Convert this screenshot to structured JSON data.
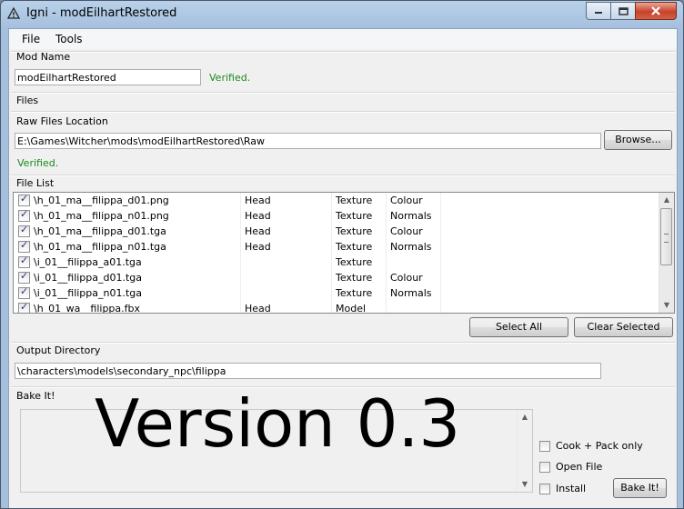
{
  "window": {
    "title": "Igni - modEilhartRestored"
  },
  "menu": {
    "file": "File",
    "tools": "Tools"
  },
  "mod_name": {
    "label": "Mod Name",
    "value": "modEilhartRestored",
    "status": "Verified."
  },
  "files_section": {
    "label": "Files"
  },
  "raw_files": {
    "label": "Raw Files Location",
    "value": "E:\\Games\\Witcher\\mods\\modEilhartRestored\\Raw",
    "browse_label": "Browse...",
    "status": "Verified."
  },
  "file_list": {
    "label": "File List",
    "rows": [
      {
        "checked": true,
        "name": "\\h_01_ma__filippa_d01.png",
        "group": "Head",
        "type": "Texture",
        "kind": "Colour"
      },
      {
        "checked": true,
        "name": "\\h_01_ma__filippa_n01.png",
        "group": "Head",
        "type": "Texture",
        "kind": "Normals"
      },
      {
        "checked": true,
        "name": "\\h_01_ma__filippa_d01.tga",
        "group": "Head",
        "type": "Texture",
        "kind": "Colour"
      },
      {
        "checked": true,
        "name": "\\h_01_ma__filippa_n01.tga",
        "group": "Head",
        "type": "Texture",
        "kind": "Normals"
      },
      {
        "checked": true,
        "name": "\\i_01__filippa_a01.tga",
        "group": "",
        "type": "Texture",
        "kind": ""
      },
      {
        "checked": true,
        "name": "\\i_01__filippa_d01.tga",
        "group": "",
        "type": "Texture",
        "kind": "Colour"
      },
      {
        "checked": true,
        "name": "\\i_01__filippa_n01.tga",
        "group": "",
        "type": "Texture",
        "kind": "Normals"
      },
      {
        "checked": true,
        "name": "\\h_01_wa__filippa.fbx",
        "group": "Head",
        "type": "Model",
        "kind": ""
      }
    ],
    "select_all_label": "Select All",
    "clear_selected_label": "Clear Selected"
  },
  "output": {
    "label": "Output Directory",
    "value": "\\characters\\models\\secondary_npc\\filippa"
  },
  "bake": {
    "label": "Bake It!",
    "overlay_text": "Version 0.3",
    "cook_pack_label": "Cook + Pack only",
    "open_file_label": "Open File",
    "install_label": "Install",
    "bake_button_label": "Bake It!"
  }
}
